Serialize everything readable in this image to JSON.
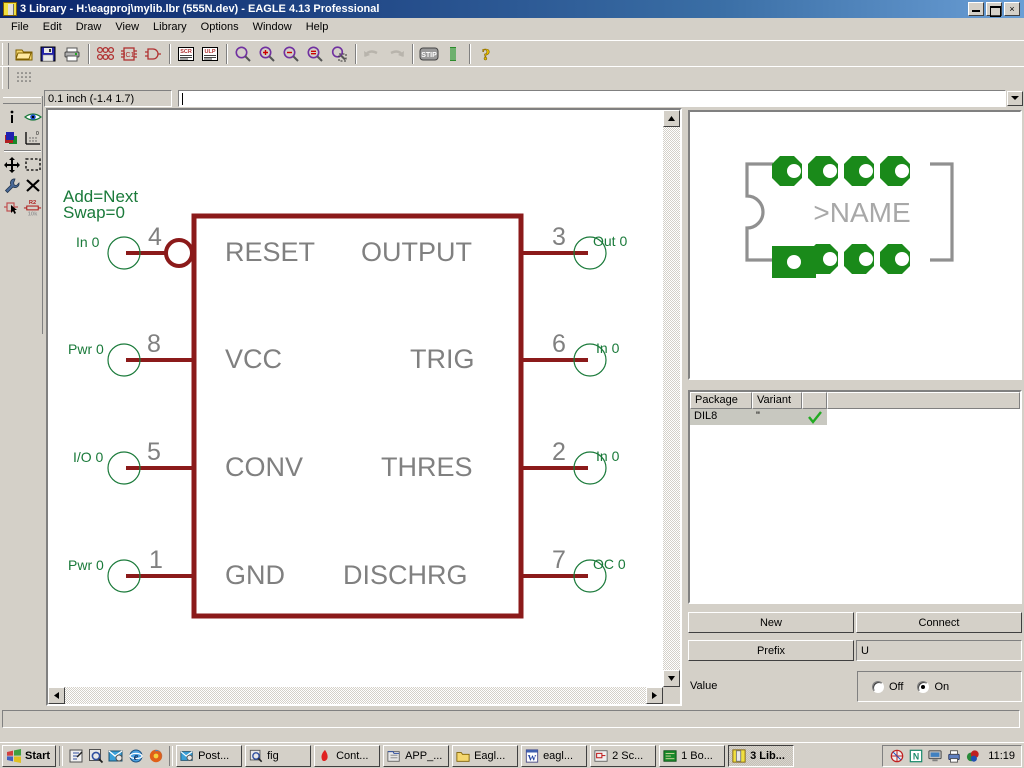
{
  "window": {
    "title": "3 Library - H:\\eagproj\\mylib.lbr (555N.dev) - EAGLE 4.13 Professional",
    "icon": "eagle-library-icon",
    "minimize_label": "",
    "maximize_label": "",
    "close_label": "×"
  },
  "menu": [
    {
      "label": "File"
    },
    {
      "label": "Edit"
    },
    {
      "label": "Draw"
    },
    {
      "label": "View"
    },
    {
      "label": "Library"
    },
    {
      "label": "Options"
    },
    {
      "label": "Window"
    },
    {
      "label": "Help"
    }
  ],
  "toolbar": {
    "items": [
      {
        "name": "open-icon",
        "tip": "Open"
      },
      {
        "name": "save-icon",
        "tip": "Save"
      },
      {
        "name": "print-icon",
        "tip": "Print"
      },
      {
        "name": "package-icon",
        "tip": "Package"
      },
      {
        "name": "symbol-icon",
        "tip": "Symbol"
      },
      {
        "name": "device-icon",
        "tip": "Device"
      },
      {
        "name": "script-icon",
        "tip": "SCR"
      },
      {
        "name": "ulp-icon",
        "tip": "ULP"
      },
      {
        "name": "zoom-fit-icon",
        "tip": "Zoom to fit"
      },
      {
        "name": "zoom-in-icon",
        "tip": "Zoom in"
      },
      {
        "name": "zoom-out-icon",
        "tip": "Zoom out"
      },
      {
        "name": "zoom-redraw-icon",
        "tip": "Redraw"
      },
      {
        "name": "zoom-select-icon",
        "tip": "Zoom select"
      },
      {
        "name": "undo-icon",
        "tip": "Undo"
      },
      {
        "name": "redo-icon",
        "tip": "Redo"
      },
      {
        "name": "stop-icon",
        "tip": "Stop"
      },
      {
        "name": "run-icon",
        "tip": "Run"
      },
      {
        "name": "help-icon",
        "tip": "Help"
      }
    ],
    "grid_icon": "grid-icon"
  },
  "left_toolbar": {
    "items": [
      {
        "name": "info-icon"
      },
      {
        "name": "display-eye-icon"
      },
      {
        "name": "layers-icon"
      },
      {
        "name": "grid-settings-icon"
      },
      {
        "name": "move-icon"
      },
      {
        "name": "group-icon"
      },
      {
        "name": "change-wrench-icon"
      },
      {
        "name": "delete-x-icon"
      },
      {
        "name": "pin-cursor-icon"
      },
      {
        "name": "resistor-value-icon"
      }
    ],
    "resistor_label_top": "R2",
    "resistor_label_bottom": "10k"
  },
  "coordbar": {
    "coordinates": "0.1 inch (-1.4 1.7)",
    "command_value": "",
    "command_placeholder": "",
    "dropdown_icon": "chevron-down-icon"
  },
  "schematic": {
    "attributes": [
      "Add=Next",
      "Swap=0"
    ],
    "colors": {
      "symbol": "#8b1a1a",
      "pin_name": "#808080",
      "pin_number": "#808080",
      "direction_label": "#1a7a3a"
    },
    "pins_left": [
      {
        "number": "4",
        "name": "RESET",
        "direction": "In 0",
        "inverted": true
      },
      {
        "number": "8",
        "name": "VCC",
        "direction": "Pwr 0",
        "inverted": false
      },
      {
        "number": "5",
        "name": "CONV",
        "direction": "I/O 0",
        "inverted": false
      },
      {
        "number": "1",
        "name": "GND",
        "direction": "Pwr 0",
        "inverted": false
      }
    ],
    "pins_right": [
      {
        "number": "3",
        "name": "OUTPUT",
        "direction": "Out 0",
        "inverted": false
      },
      {
        "number": "6",
        "name": "TRIG",
        "direction": "In 0",
        "inverted": false
      },
      {
        "number": "2",
        "name": "THRES",
        "direction": "In 0",
        "inverted": false
      },
      {
        "number": "7",
        "name": "DISCHRG",
        "direction": "OC 0",
        "inverted": false
      }
    ]
  },
  "package_view": {
    "name_text": ">NAME",
    "pad_color": "#1a8a1a",
    "outline_color": "#909090",
    "pad_count": 8,
    "first_pad_shape": "square"
  },
  "package_table": {
    "columns": [
      "Package",
      "Variant",
      ""
    ],
    "rows": [
      {
        "package": "DIL8",
        "variant": "\"",
        "checked": true,
        "check_icon": "check-icon"
      }
    ]
  },
  "device_panel": {
    "new_label": "New",
    "connect_label": "Connect",
    "prefix_label": "Prefix",
    "prefix_value": "U",
    "value_label": "Value",
    "value_off_label": "Off",
    "value_on_label": "On",
    "value_selected": "On"
  },
  "statusbar": {
    "text": ""
  },
  "taskbar": {
    "start_label": "Start",
    "quick_launch": [
      {
        "name": "show-desktop-icon"
      },
      {
        "name": "search-icon"
      },
      {
        "name": "explorer-icon"
      },
      {
        "name": "internet-explorer-icon"
      },
      {
        "name": "firefox-icon"
      }
    ],
    "items": [
      {
        "label": "Post...",
        "icon": "explorer-icon",
        "active": false
      },
      {
        "label": "fig",
        "icon": "search-icon",
        "active": false
      },
      {
        "label": "Cont...",
        "icon": "acrobat-icon",
        "active": false
      },
      {
        "label": "APP_...",
        "icon": "folder-app-icon",
        "active": false
      },
      {
        "label": "Eagl...",
        "icon": "folder-icon",
        "active": false
      },
      {
        "label": "eagl...",
        "icon": "word-icon",
        "active": false
      },
      {
        "label": "2 Sc...",
        "icon": "eagle-schematic-icon",
        "active": false
      },
      {
        "label": "1 Bo...",
        "icon": "eagle-board-icon",
        "active": false
      },
      {
        "label": "3 Lib...",
        "icon": "eagle-library-icon",
        "active": true
      }
    ],
    "tray": [
      {
        "name": "network-icon"
      },
      {
        "name": "norton-icon"
      },
      {
        "name": "monitor-icon"
      },
      {
        "name": "printer-icon"
      },
      {
        "name": "volume-icon"
      }
    ],
    "time": "11:19"
  }
}
